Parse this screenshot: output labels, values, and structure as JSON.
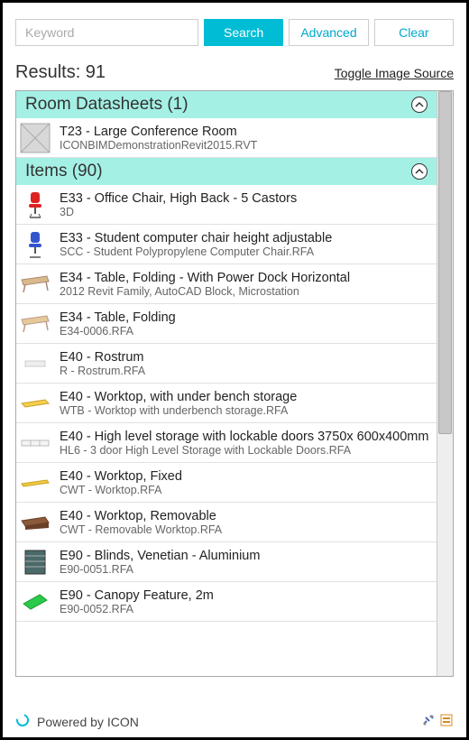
{
  "search": {
    "placeholder": "Keyword",
    "search_label": "Search",
    "advanced_label": "Advanced",
    "clear_label": "Clear"
  },
  "results_label": "Results: 91",
  "toggle_label": "Toggle Image Source",
  "groups": {
    "room": {
      "header": "Room Datasheets (1)",
      "items": [
        {
          "title": "T23 - Large Conference Room",
          "sub": "ICONBIMDemonstrationRevit2015.RVT",
          "icon": "placeholder"
        }
      ]
    },
    "items": {
      "header": "Items (90)",
      "items": [
        {
          "title": "E33 - Office Chair, High Back - 5 Castors",
          "sub": "3D",
          "icon": "chair-red"
        },
        {
          "title": "E33 - Student computer chair height adjustable",
          "sub": "SCC - Student Polypropylene Computer Chair.RFA",
          "icon": "chair-blue"
        },
        {
          "title": "E34 - Table, Folding - With Power Dock Horizontal",
          "sub": "2012 Revit Family, AutoCAD Block, Microstation",
          "icon": "table-tan"
        },
        {
          "title": "E34 - Table, Folding",
          "sub": "E34-0006.RFA",
          "icon": "table-tan2"
        },
        {
          "title": "E40 - Rostrum",
          "sub": "R - Rostrum.RFA",
          "icon": "rostrum"
        },
        {
          "title": "E40 - Worktop, with under bench storage",
          "sub": "WTB - Worktop with underbench storage.RFA",
          "icon": "worktop-yellow"
        },
        {
          "title": "E40 - High level storage with lockable doors 3750x 600x400mm",
          "sub": "HL6 - 3 door High Level Storage with Lockable Doors.RFA",
          "icon": "storage"
        },
        {
          "title": "E40 - Worktop, Fixed",
          "sub": "CWT - Worktop.RFA",
          "icon": "worktop-flat"
        },
        {
          "title": "E40 - Worktop, Removable",
          "sub": "CWT - Removable Worktop.RFA",
          "icon": "worktop-brown"
        },
        {
          "title": "E90 - Blinds, Venetian - Aluminium",
          "sub": "E90-0051.RFA",
          "icon": "blinds"
        },
        {
          "title": "E90 - Canopy Feature, 2m",
          "sub": "E90-0052.RFA",
          "icon": "canopy-green"
        }
      ]
    }
  },
  "footer": {
    "powered": "Powered by ICON"
  }
}
